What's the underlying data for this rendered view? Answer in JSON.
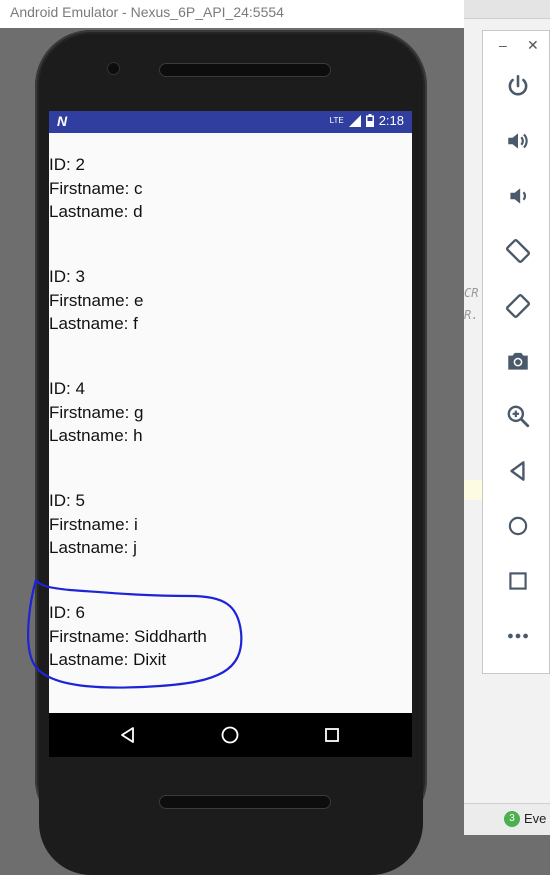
{
  "window": {
    "title": "Android Emulator - Nexus_6P_API_24:5554"
  },
  "status_bar": {
    "network": "LTE",
    "time": "2:18"
  },
  "records": [
    {
      "id": "ID: 2",
      "firstname": "Firstname: c",
      "lastname": "Lastname: d"
    },
    {
      "id": "ID: 3",
      "firstname": "Firstname: e",
      "lastname": "Lastname: f"
    },
    {
      "id": "ID: 4",
      "firstname": "Firstname: g",
      "lastname": "Lastname: h"
    },
    {
      "id": "ID: 5",
      "firstname": "Firstname: i",
      "lastname": "Lastname: j"
    },
    {
      "id": "ID: 6",
      "firstname": "Firstname: Siddharth",
      "lastname": "Lastname: Dixit"
    }
  ],
  "ide": {
    "code_line_1": "CR",
    "code_line_2": "R.",
    "status_badge_count": "3",
    "status_text": "Eve"
  },
  "controls": {
    "minimize_label": "–",
    "close_label": "✕",
    "icons": [
      "power-icon",
      "volume-up-icon",
      "volume-down-icon",
      "rotate-left-icon",
      "rotate-right-icon",
      "camera-icon",
      "zoom-icon",
      "back-icon",
      "home-icon",
      "overview-icon",
      "more-icon"
    ]
  },
  "colors": {
    "status_bar": "#303f9f",
    "annotation": "#1d23d6",
    "control_icon": "#4a5a6a"
  }
}
